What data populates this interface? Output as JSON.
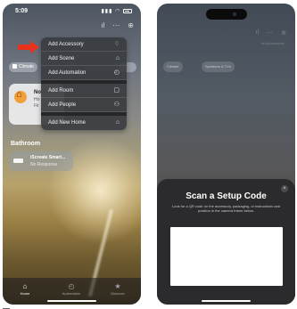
{
  "left_screen": {
    "status_time": "5:09",
    "top_icons": [
      "waveform-icon",
      "more-icon",
      "add-icon"
    ],
    "chips": [
      {
        "label": "Climate"
      },
      {
        "label": ""
      }
    ],
    "accessory_card": {
      "line1": "No",
      "line2": "Ho",
      "line3": "Fir"
    },
    "section_title": "Bathroom",
    "scene_card": {
      "name": "iScreate Smart...",
      "sub": "No Response"
    },
    "menu": {
      "items": [
        {
          "label": "Add Accessory",
          "icon": "lightbulb-icon"
        },
        {
          "label": "Add Scene",
          "icon": "house-icon"
        },
        {
          "label": "Add Automation",
          "icon": "clock-icon"
        },
        {
          "label": "Add Room",
          "icon": "room-icon"
        },
        {
          "label": "Add People",
          "icon": "people-icon"
        },
        {
          "label": "Add New Home",
          "icon": "home-icon"
        }
      ]
    },
    "tabs": [
      {
        "label": "Home",
        "icon": "house-icon",
        "active": true
      },
      {
        "label": "Automation",
        "icon": "clock-icon",
        "active": false
      },
      {
        "label": "Discover",
        "icon": "star-icon",
        "active": false
      }
    ]
  },
  "right_screen": {
    "dim_caption": "all Accessories",
    "dim_chips": [
      {
        "label": "Climate"
      },
      {
        "label": "Speakers & TVs"
      }
    ],
    "sheet": {
      "title": "Scan a Setup Code",
      "description": "Look for a QR code on the accessory, packaging, or instructions and position in the camera frame below.",
      "close_label": "×"
    }
  },
  "colors": {
    "arrow": "#e8321e",
    "menu_bg": "#3a3c40",
    "sheet_bg": "#2b2b2d",
    "camera_frame": "#ffffff"
  }
}
